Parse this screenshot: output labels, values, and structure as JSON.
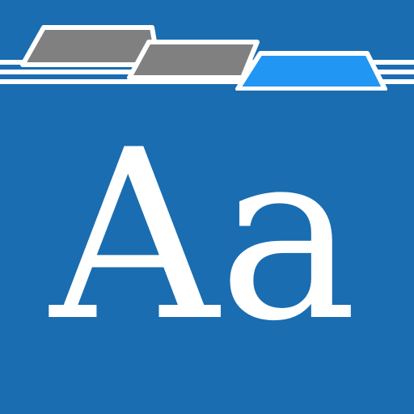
{
  "icon": {
    "name": "font-folder-icon",
    "glyph_text": "Aa",
    "colors": {
      "background": "#1a6db0",
      "stripes": "#ffffff",
      "tab_inactive": "#808080",
      "tab_active": "#2196f3",
      "tab_outline": "#ffffff",
      "glyph": "#ffffff"
    }
  }
}
